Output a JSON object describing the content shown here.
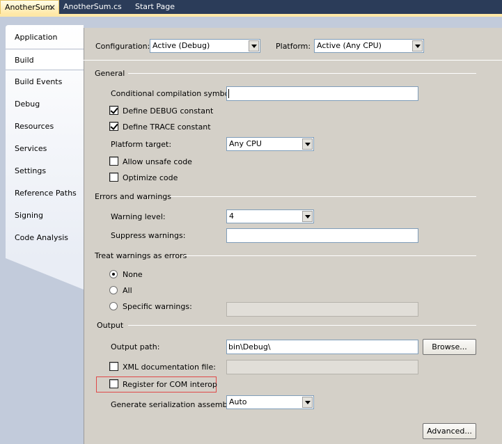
{
  "tabs": [
    {
      "label": "AnotherSum",
      "close_glyph": "✕"
    },
    {
      "label": "AnotherSum.cs"
    },
    {
      "label": "Start Page"
    }
  ],
  "sidebar": {
    "items": [
      {
        "label": "Application"
      },
      {
        "label": "Build"
      },
      {
        "label": "Build Events"
      },
      {
        "label": "Debug"
      },
      {
        "label": "Resources"
      },
      {
        "label": "Services"
      },
      {
        "label": "Settings"
      },
      {
        "label": "Reference Paths"
      },
      {
        "label": "Signing"
      },
      {
        "label": "Code Analysis"
      }
    ],
    "selected": "Build"
  },
  "top": {
    "configuration_label": "Configuration:",
    "configuration_value": "Active (Debug)",
    "platform_label": "Platform:",
    "platform_value": "Active (Any CPU)"
  },
  "general": {
    "header": "General",
    "cond_symbols_label": "Conditional compilation symbols:",
    "cond_symbols_value": "",
    "define_debug_label": "Define DEBUG constant",
    "define_debug_checked": true,
    "define_trace_label": "Define TRACE constant",
    "define_trace_checked": true,
    "platform_target_label": "Platform target:",
    "platform_target_value": "Any CPU",
    "allow_unsafe_label": "Allow unsafe code",
    "allow_unsafe_checked": false,
    "optimize_label": "Optimize code",
    "optimize_checked": false
  },
  "errors": {
    "header": "Errors and warnings",
    "warning_level_label": "Warning level:",
    "warning_level_value": "4",
    "suppress_label": "Suppress warnings:",
    "suppress_value": ""
  },
  "treat": {
    "header": "Treat warnings as errors",
    "none_label": "None",
    "all_label": "All",
    "specific_label": "Specific warnings:",
    "selected": "None"
  },
  "output": {
    "header": "Output",
    "path_label": "Output path:",
    "path_value": "bin\\Debug\\",
    "browse_label": "Browse...",
    "xml_doc_label": "XML documentation file:",
    "xml_doc_checked": false,
    "com_interop_label": "Register for COM interop",
    "com_interop_checked": false,
    "serialization_label": "Generate serialization assembly:",
    "serialization_value": "Auto",
    "advanced_label": "Advanced..."
  },
  "colors": {
    "tab_strip": "#2b3c59",
    "active_tab": "#ffe8a6",
    "panel": "#d4d0c8",
    "highlight_border": "#e04848"
  }
}
